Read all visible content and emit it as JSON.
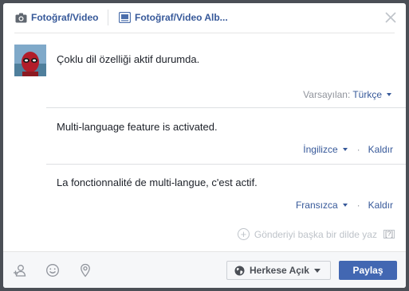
{
  "header": {
    "tabs": [
      {
        "label": "Fotoğraf/Video",
        "icon": "camera-icon"
      },
      {
        "label": "Fotoğraf/Video Alb...",
        "icon": "photo-album-icon"
      }
    ],
    "close_icon": "close-icon"
  },
  "composer": {
    "main_text": "Çoklu dil özelliği aktif durumda.",
    "default_label": "Varsayılan:",
    "default_language": "Türkçe"
  },
  "translations": [
    {
      "text": "Multi-language feature is activated.",
      "language": "İngilizce",
      "remove": "Kaldır"
    },
    {
      "text": "La fonctionnalité de multi-langue, c'est actif.",
      "language": "Fransızca",
      "remove": "Kaldır"
    }
  ],
  "write_another": {
    "label": "Gönderiyi başka bir dilde yaz",
    "help": "[?]"
  },
  "footer": {
    "icons": [
      "tag-people-icon",
      "feeling-icon",
      "location-pin-icon"
    ],
    "audience_label": "Herkese Açık",
    "share_label": "Paylaş"
  },
  "colors": {
    "link": "#365899",
    "primary_button": "#4267b2",
    "muted": "#90949c",
    "overlay": "#4b4f56"
  }
}
